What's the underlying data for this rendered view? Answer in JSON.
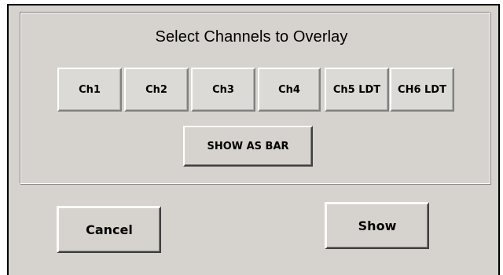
{
  "group": {
    "title": "Select Channels to Overlay"
  },
  "channels": [
    {
      "label": "Ch1"
    },
    {
      "label": "Ch2"
    },
    {
      "label": "Ch3"
    },
    {
      "label": "Ch4"
    },
    {
      "label": "Ch5 LDT"
    },
    {
      "label": "CH6 LDT"
    }
  ],
  "show_as_bar_label": "SHOW AS BAR",
  "cancel_label": "Cancel",
  "show_label": "Show"
}
